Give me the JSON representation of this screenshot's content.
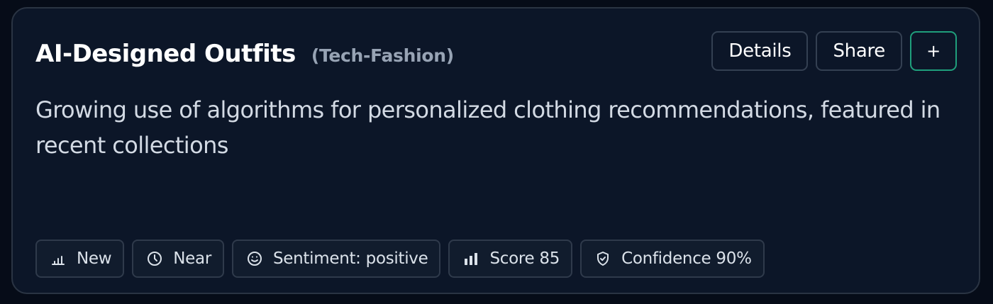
{
  "card": {
    "title": "AI-Designed Outfits",
    "category": "(Tech-Fashion)",
    "description": "Growing use of algorithms for personalized clothing recommendations, featured in recent collections"
  },
  "actions": {
    "details_label": "Details",
    "share_label": "Share",
    "add_label": "+"
  },
  "badges": [
    {
      "icon": "signal-low-icon",
      "label": "New"
    },
    {
      "icon": "clock-icon",
      "label": "Near"
    },
    {
      "icon": "smile-icon",
      "label": "Sentiment: positive"
    },
    {
      "icon": "bar-chart-icon",
      "label": "Score 85"
    },
    {
      "icon": "shield-check-icon",
      "label": "Confidence 90%"
    }
  ],
  "colors": {
    "background": "#060c18",
    "card": "#0c1628",
    "accent_border": "#1f9f7c",
    "text": "#ffffff",
    "muted": "#97a3b4"
  }
}
